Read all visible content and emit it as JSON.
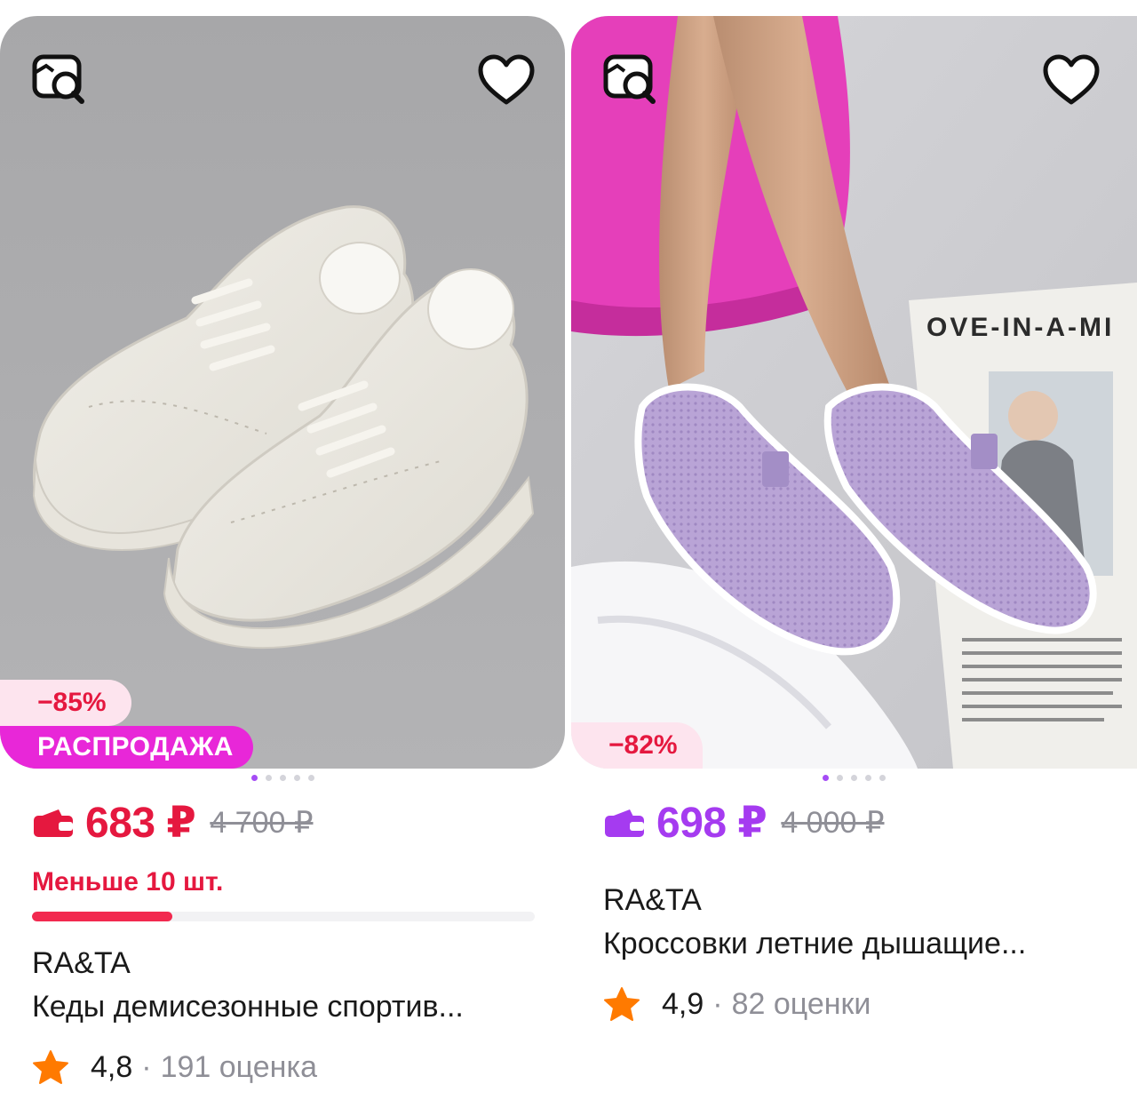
{
  "colors": {
    "price_red": "#e5183f",
    "price_purple": "#a53bf0",
    "star_orange": "#ff7a00",
    "sale_magenta": "#e827d8",
    "stock_red": "#f2294f"
  },
  "products": [
    {
      "image_alt": "Белые кеды",
      "search_icon": "image-search-icon",
      "favorite_icon": "heart-icon",
      "discount": "−85%",
      "sale_label": "РАСПРОДАЖА",
      "carousel_total": 5,
      "carousel_active": 1,
      "wallet_icon": "wallet-icon",
      "price": "683 ₽",
      "old_price": "4 700 ₽",
      "stock_text": "Меньше 10 шт.",
      "stock_level": 0.28,
      "brand": "RA&TA",
      "title": "Кеды демисезонные спортив...",
      "rating": "4,8",
      "separator": "·",
      "reviews": "191 оценка"
    },
    {
      "image_alt": "Сиреневые кроссовки",
      "search_icon": "image-search-icon",
      "favorite_icon": "heart-icon",
      "discount": "−82%",
      "magazine_text": "OVE-IN-A-MI",
      "carousel_total": 5,
      "carousel_active": 1,
      "wallet_icon": "wallet-icon",
      "price": "698 ₽",
      "old_price": "4 000 ₽",
      "brand": "RA&TA",
      "title": "Кроссовки летние дышащие...",
      "rating": "4,9",
      "separator": "·",
      "reviews": "82 оценки"
    }
  ]
}
